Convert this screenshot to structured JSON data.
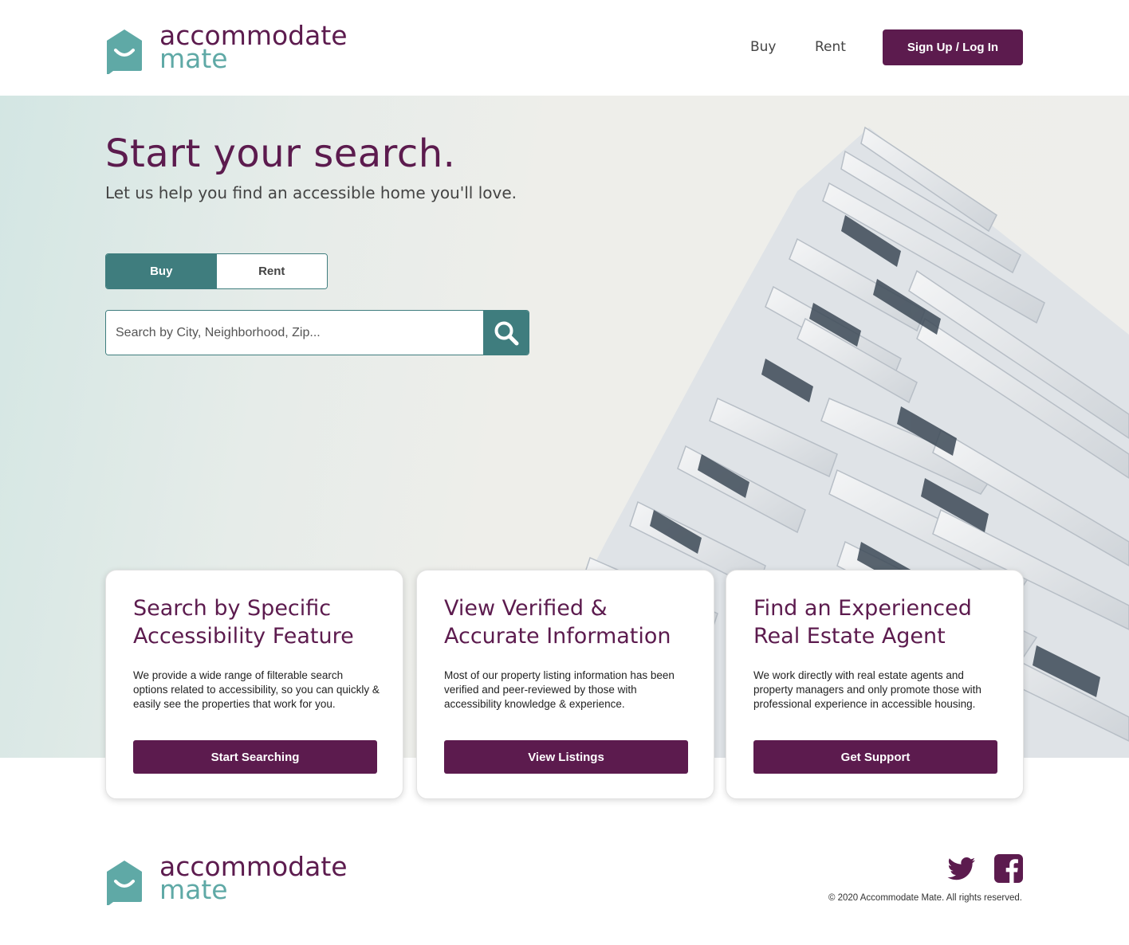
{
  "brand": {
    "line1": "accommodate",
    "line2": "mate",
    "primary_color": "#5c1b4e",
    "accent_color": "#5fa9a6",
    "teal_color": "#3f7d7e"
  },
  "nav": {
    "buy": "Buy",
    "rent": "Rent",
    "signup": "Sign Up / Log In"
  },
  "hero": {
    "title": "Start your search.",
    "subtitle": "Let us help you find an accessible home you'll love.",
    "toggle": {
      "buy": "Buy",
      "rent": "Rent",
      "selected": "Buy"
    },
    "search": {
      "placeholder": "Search by City, Neighborhood, Zip...",
      "value": "",
      "icon": "search-icon"
    }
  },
  "cards": [
    {
      "title": "Search by Specific Accessibility Feature",
      "body": "We provide a wide range of filterable search options related to accessibility, so you can quickly & easily see the properties that work for you.",
      "button": "Start Searching"
    },
    {
      "title": "View Verified & Accurate Information",
      "body": "Most of our property listing information has been verified and peer-reviewed by those with accessibility knowledge & experience.",
      "button": "View Listings"
    },
    {
      "title": "Find an Experienced Real Estate Agent",
      "body": "We work directly with real estate agents and property managers and only promote those with professional experience in accessible housing.",
      "button": "Get Support"
    }
  ],
  "footer": {
    "social": [
      "twitter-icon",
      "facebook-icon"
    ],
    "copyright": "© 2020 Accommodate Mate. All rights reserved."
  }
}
